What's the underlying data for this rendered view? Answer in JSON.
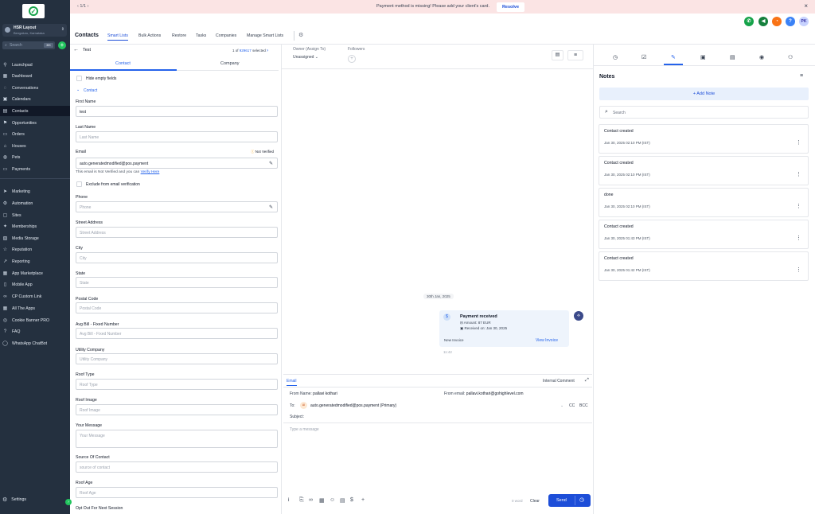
{
  "banner": {
    "pagination": "1/1",
    "message": "Payment method is missing! Please add your client's card.",
    "resolve_label": "Resolve"
  },
  "sidebar": {
    "location_name": "HSR Layout",
    "location_sub": "Bengaluru, Karnataka",
    "search_placeholder": "Search",
    "search_shortcut": "⌘K",
    "items": [
      {
        "label": "Launchpad",
        "icon": "rocket-icon",
        "glyph": "⚲"
      },
      {
        "label": "Dashboard",
        "icon": "dashboard-icon",
        "glyph": "▦"
      },
      {
        "label": "Conversations",
        "icon": "chat-icon",
        "glyph": "◌"
      },
      {
        "label": "Calendars",
        "icon": "calendar-icon",
        "glyph": "▣"
      },
      {
        "label": "Contacts",
        "icon": "contacts-icon",
        "glyph": "▤"
      },
      {
        "label": "Opportunities",
        "icon": "opportunities-icon",
        "glyph": "⚑"
      },
      {
        "label": "Orders",
        "icon": "orders-icon",
        "glyph": "▭"
      },
      {
        "label": "Houses",
        "icon": "house-icon",
        "glyph": "⌂"
      },
      {
        "label": "Pets",
        "icon": "pet-icon",
        "glyph": "◍"
      },
      {
        "label": "Payments",
        "icon": "payments-icon",
        "glyph": "▭"
      },
      {
        "label": "Marketing",
        "icon": "marketing-icon",
        "glyph": "➤"
      },
      {
        "label": "Automation",
        "icon": "automation-icon",
        "glyph": "⚙"
      },
      {
        "label": "Sites",
        "icon": "sites-icon",
        "glyph": "▢"
      },
      {
        "label": "Memberships",
        "icon": "memberships-icon",
        "glyph": "✦"
      },
      {
        "label": "Media Storage",
        "icon": "media-icon",
        "glyph": "▧"
      },
      {
        "label": "Reputation",
        "icon": "star-icon",
        "glyph": "☆"
      },
      {
        "label": "Reporting",
        "icon": "reporting-icon",
        "glyph": "↗"
      },
      {
        "label": "App Marketplace",
        "icon": "marketplace-icon",
        "glyph": "▦"
      },
      {
        "label": "Mobile App",
        "icon": "mobile-icon",
        "glyph": "▯"
      },
      {
        "label": "CP Custom Link",
        "icon": "link-icon",
        "glyph": "∞"
      },
      {
        "label": "All The Apps",
        "icon": "apps-icon",
        "glyph": "▦"
      },
      {
        "label": "Cookie Banner PRO",
        "icon": "cookie-icon",
        "glyph": "◎"
      },
      {
        "label": "FAQ",
        "icon": "faq-icon",
        "glyph": "?"
      },
      {
        "label": "WhatsApp ChatBot",
        "icon": "whatsapp-icon",
        "glyph": "◯"
      }
    ],
    "settings_label": "Settings"
  },
  "topbar": {
    "avatar_initials": "PK"
  },
  "topnav": {
    "title": "Contacts",
    "tabs": [
      "Smart Lists",
      "Bulk Actions",
      "Restore",
      "Tasks",
      "Companies",
      "Manage Smart Lists"
    ]
  },
  "contact": {
    "name": "Test",
    "record_prefix": "1 of",
    "record_count": "929617",
    "record_suffix": "selected",
    "tabs": [
      "Contact",
      "Company"
    ],
    "hide_empty": "Hide empty fields",
    "section": "Contact",
    "fields": {
      "first_name_label": "First Name",
      "first_name_value": "test",
      "last_name_label": "Last Name",
      "last_name_placeholder": "Last Name",
      "email_label": "Email",
      "email_status": "Not Verified",
      "email_value": "auto.generatedmodified@pos.payment",
      "email_note": "This email is Not Verified and you can",
      "email_verify_link": "Verify Here",
      "exclude_label": "Exclude from email verification",
      "phone_label": "Phone",
      "phone_placeholder": "Phone",
      "street_label": "Street Address",
      "street_placeholder": "Street Address",
      "city_label": "City",
      "city_placeholder": "City",
      "state_label": "State",
      "state_placeholder": "State",
      "postal_label": "Postal Code",
      "postal_placeholder": "Postal Code",
      "avg_bill_label": "Avg Bill - Fixed Number",
      "avg_bill_placeholder": "Avg Bill - Fixed Number",
      "utility_label": "Utility Company",
      "utility_placeholder": "Utility Company",
      "roof_type_label": "Roof Type",
      "roof_type_placeholder": "Roof Type",
      "roof_image_label": "Roof Image",
      "roof_image_placeholder": "Roof Image",
      "message_label": "Your Message",
      "message_placeholder": "Your Message",
      "source_label": "Source Of Contact",
      "source_placeholder": "source of contact",
      "roof_age_label": "Roof Age",
      "roof_age_placeholder": "Roof Age",
      "opt_out_label": "Opt Out For Next Session"
    }
  },
  "conversation": {
    "owner_label": "Owner (Assign To)",
    "owner_value": "Unassigned",
    "followers_label": "Followers",
    "date_chip": "30th Jan, 2025",
    "payment": {
      "title": "Payment received",
      "amount": "Amount: 87 EUR",
      "received": "Received on: Jan 30, 2025",
      "left_label": "New Invoice",
      "link": "View Invoice",
      "time": "11:42"
    }
  },
  "composer": {
    "tab": "Email",
    "internal_comment": "Internal Comment",
    "from_name_label": "From Name:",
    "from_name_value": "pallavi kothari",
    "from_email_label": "From email:",
    "from_email_value": "pallavi.kothari@gohighlevel.com",
    "to_label": "To:",
    "to_avatar": "AI",
    "to_value": "auto.generatedmodified@pos.payment (Primary)",
    "cc": "CC",
    "bcc": "BCC",
    "subject_label": "Subject:",
    "message_placeholder": "Type a message",
    "word_count": "0 word",
    "clear_label": "Clear",
    "send_label": "Send"
  },
  "notes": {
    "title": "Notes",
    "add_label": "+ Add Note",
    "search_placeholder": "Search",
    "items": [
      {
        "title": "Contact created",
        "date": "Jan 30, 2025 02:10 PM (IST)"
      },
      {
        "title": "Contact created",
        "date": "Jan 30, 2025 02:10 PM (IST)"
      },
      {
        "title": "done",
        "date": "Jan 30, 2025 02:10 PM (IST)"
      },
      {
        "title": "Contact created",
        "date": "Jan 30, 2025 01:43 PM (IST)"
      },
      {
        "title": "Contact created",
        "date": "Jan 30, 2025 01:42 PM (IST)"
      }
    ]
  },
  "colors": {
    "sidebar_bg": "#24303f",
    "accent": "#1d4ed8",
    "banner_bg": "#fbe4e4",
    "success": "#22c55e",
    "warning": "#f59e0b"
  }
}
